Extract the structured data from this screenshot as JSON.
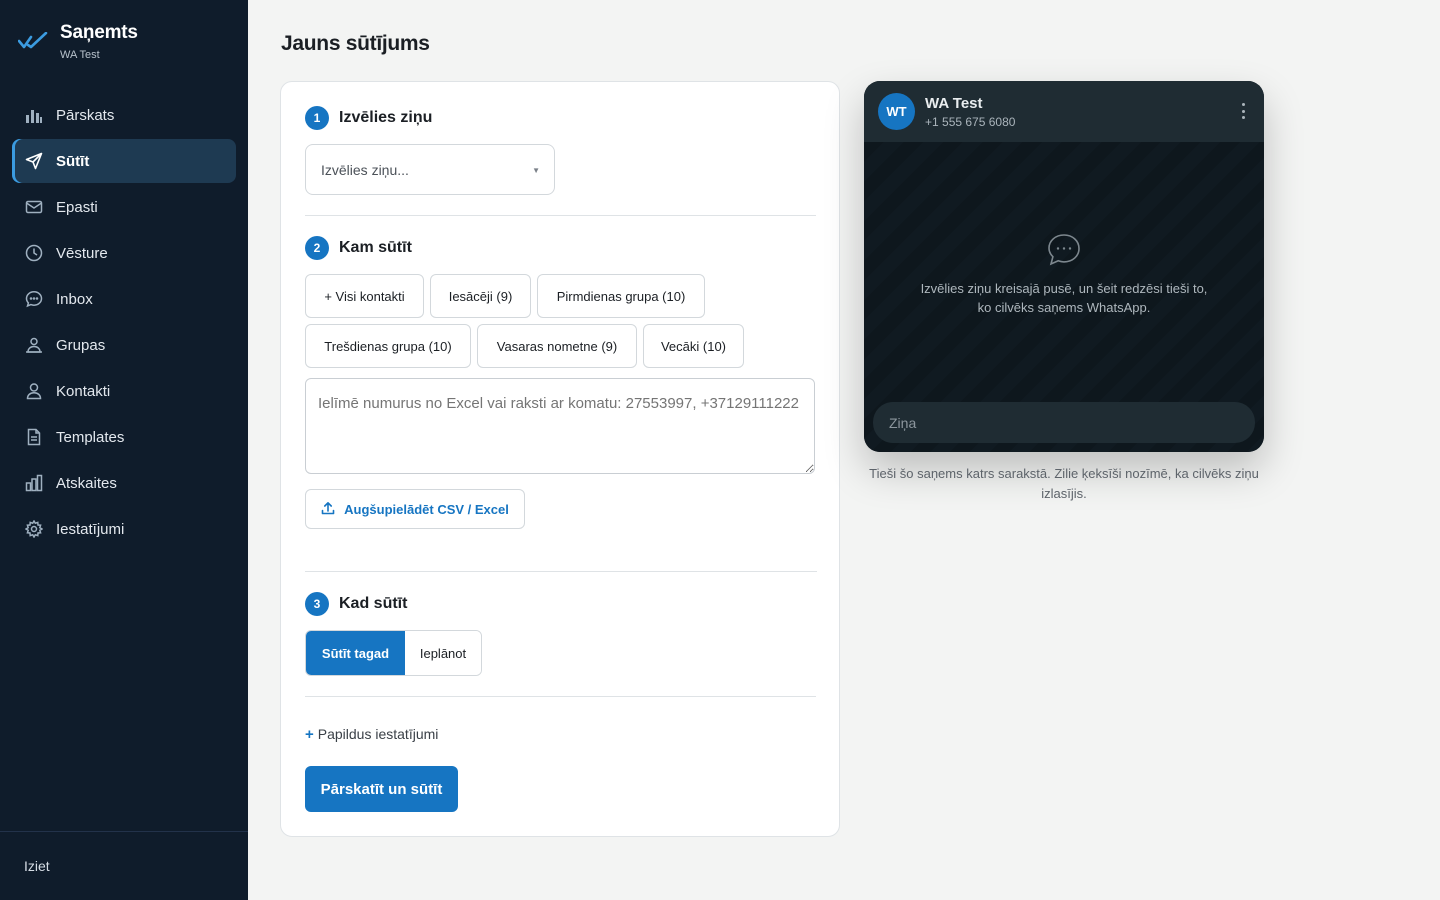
{
  "brand": {
    "name": "Saņemts",
    "account": "WA Test"
  },
  "nav": [
    {
      "label": "Pārskats",
      "icon": "bar-chart-icon",
      "active": false
    },
    {
      "label": "Sūtīt",
      "icon": "send-icon",
      "active": true
    },
    {
      "label": "Epasti",
      "icon": "mail-icon",
      "active": false
    },
    {
      "label": "Vēsture",
      "icon": "clock-icon",
      "active": false
    },
    {
      "label": "Inbox",
      "icon": "chat-bubble-icon",
      "active": false
    },
    {
      "label": "Grupas",
      "icon": "users-icon",
      "active": false
    },
    {
      "label": "Kontakti",
      "icon": "user-icon",
      "active": false
    },
    {
      "label": "Templates",
      "icon": "document-icon",
      "active": false
    },
    {
      "label": "Atskaites",
      "icon": "reports-icon",
      "active": false
    },
    {
      "label": "Iestatījumi",
      "icon": "gear-icon",
      "active": false
    }
  ],
  "logout": "Iziet",
  "page": {
    "title": "Jauns sūtījums"
  },
  "steps": {
    "s1": {
      "num": "1",
      "title": "Izvēlies ziņu",
      "select_placeholder": "Izvēlies ziņu..."
    },
    "s2": {
      "num": "2",
      "title": "Kam sūtīt",
      "chips": [
        "+ Visi kontakti",
        "Iesācēji (9)",
        "Pirmdienas grupa (10)",
        "Trešdienas grupa (10)",
        "Vasaras nometne (9)",
        "Vecāki (10)"
      ],
      "numbers_placeholder": "Ielīmē numurus no Excel vai raksti ar komatu: 27553997, +37129111222",
      "upload_label": "Augšupielādēt CSV / Excel"
    },
    "s3": {
      "num": "3",
      "title": "Kad sūtīt",
      "send_now": "Sūtīt tagad",
      "schedule": "Ieplānot"
    }
  },
  "extra_settings": "Papildus iestatījumi",
  "submit_label": "Pārskatīt un sūtīt",
  "preview": {
    "avatar_initials": "WT",
    "contact_name": "WA Test",
    "contact_number": "+1 555 675 6080",
    "hint": "Izvēlies ziņu kreisajā pusē, un šeit redzēsi tieši to, ko cilvēks saņems WhatsApp.",
    "input_placeholder": "Ziņa",
    "caption": "Tieši šo saņems katrs sarakstā. Zilie ķeksīši nozīmē, ka cilvēks ziņu izlasījis."
  },
  "colors": {
    "accent": "#1675c2",
    "sidebar_bg": "#0f1c2b",
    "active_bg": "#1e3a52",
    "chat_bg": "#0b141a"
  }
}
